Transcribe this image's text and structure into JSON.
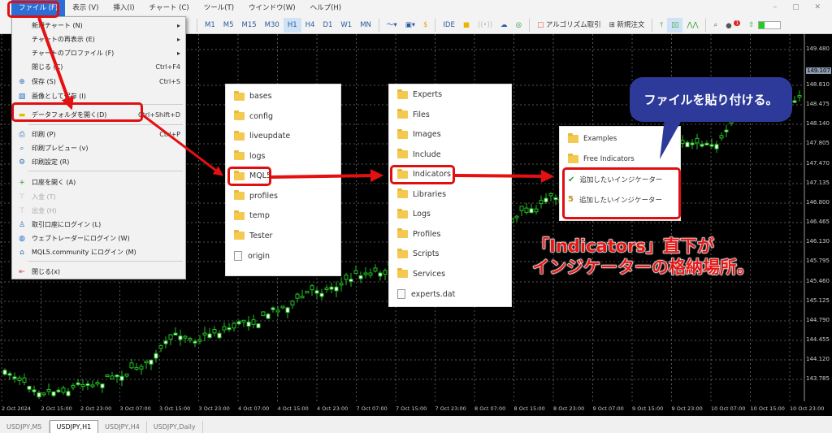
{
  "menubar": {
    "items": [
      "ファイル (F)",
      "表示 (V)",
      "挿入(I)",
      "チャート (C)",
      "ツール(T)",
      "ウインドウ(W)",
      "ヘルプ(H)"
    ]
  },
  "toolbar": {
    "timeframes": [
      "M1",
      "M5",
      "M15",
      "M30",
      "H1",
      "H4",
      "D1",
      "W1",
      "MN"
    ],
    "selected_timeframe": "H1",
    "ide": "IDE",
    "algo": "アルゴリズム取引",
    "new_order": "新規注文",
    "notification_count": "1"
  },
  "file_menu": [
    {
      "label": "新規チャート (N)",
      "shortcut": "",
      "submenu": true,
      "icon": ""
    },
    {
      "label": "チャートの再表示 (E)",
      "shortcut": "",
      "submenu": true,
      "icon": ""
    },
    {
      "label": "チャートのプロファイル (F)",
      "shortcut": "",
      "submenu": true,
      "icon": ""
    },
    {
      "label": "閉じる (C)",
      "shortcut": "Ctrl+F4",
      "icon": ""
    },
    {
      "label": "保存 (S)",
      "shortcut": "Ctrl+S",
      "icon": "save-icon"
    },
    {
      "label": "画像として保存 (I)",
      "shortcut": "",
      "icon": "image-icon"
    },
    {
      "label": "データフォルダを開く(D)",
      "shortcut": "Ctrl+Shift+D",
      "icon": "folder-icon"
    },
    {
      "label": "印刷 (P)",
      "shortcut": "Ctrl+P",
      "icon": "print-icon"
    },
    {
      "label": "印刷プレビュー (v)",
      "shortcut": "",
      "icon": "print-preview-icon"
    },
    {
      "label": "印刷設定 (R)",
      "shortcut": "",
      "icon": "print-settings-icon"
    },
    {
      "label": "口座を開く (A)",
      "shortcut": "",
      "icon": "plus-icon"
    },
    {
      "label": "入金 (T)",
      "shortcut": "",
      "icon": "deposit-icon",
      "disabled": true
    },
    {
      "label": "出金 (H)",
      "shortcut": "",
      "icon": "withdraw-icon",
      "disabled": true
    },
    {
      "label": "取引口座にログイン (L)",
      "shortcut": "",
      "icon": "user-icon"
    },
    {
      "label": "ウェブトレーダーにログイン (W)",
      "shortcut": "",
      "icon": "globe-icon"
    },
    {
      "label": "MQL5.community にログイン (M)",
      "shortcut": "",
      "icon": "graduation-cap-icon"
    },
    {
      "label": "閉じる(x)",
      "shortcut": "",
      "icon": "exit-icon"
    }
  ],
  "data_folder": [
    "bases",
    "config",
    "liveupdate",
    "logs",
    "MQL5",
    "profiles",
    "temp",
    "Tester",
    "origin"
  ],
  "mql5_folder": [
    "Experts",
    "Files",
    "Images",
    "Include",
    "Indicators",
    "Libraries",
    "Logs",
    "Profiles",
    "Scripts",
    "Services",
    "experts.dat"
  ],
  "indicators_folder": [
    "Examples",
    "Free Indicators",
    "追加したいインジケーター",
    "追加したいインジケーター"
  ],
  "callout": "ファイルを貼り付ける。",
  "annotation": [
    "「Indicators」直下が",
    "インジケーターの格納場所。"
  ],
  "price_axis": [
    "149.480",
    "148.810",
    "148.475",
    "148.140",
    "147.805",
    "147.470",
    "147.135",
    "146.800",
    "146.465",
    "146.130",
    "145.795",
    "145.460",
    "145.125",
    "144.790",
    "144.455",
    "144.120",
    "143.785"
  ],
  "current_price": "149.107",
  "time_axis": [
    "2 Oct 2024",
    "2 Oct 15:00",
    "2 Oct 23:00",
    "3 Oct 07:00",
    "3 Oct 15:00",
    "3 Oct 23:00",
    "4 Oct 07:00",
    "4 Oct 15:00",
    "4 Oct 23:00",
    "7 Oct 07:00",
    "7 Oct 15:00",
    "7 Oct 23:00",
    "8 Oct 07:00",
    "8 Oct 15:00",
    "8 Oct 23:00",
    "9 Oct 07:00",
    "9 Oct 15:00",
    "9 Oct 23:00",
    "10 Oct 07:00",
    "10 Oct 15:00",
    "10 Oct 23:00"
  ],
  "tabs": [
    "USDJPY,M5",
    "USDJPY,H1",
    "USDJPY,H4",
    "USDJPY,Daily"
  ],
  "active_tab": "USDJPY,H1",
  "colors": {
    "accent": "#2b6fd6",
    "highlight": "#e01010",
    "callout": "#2d3a9a",
    "candle": "#22c022"
  }
}
